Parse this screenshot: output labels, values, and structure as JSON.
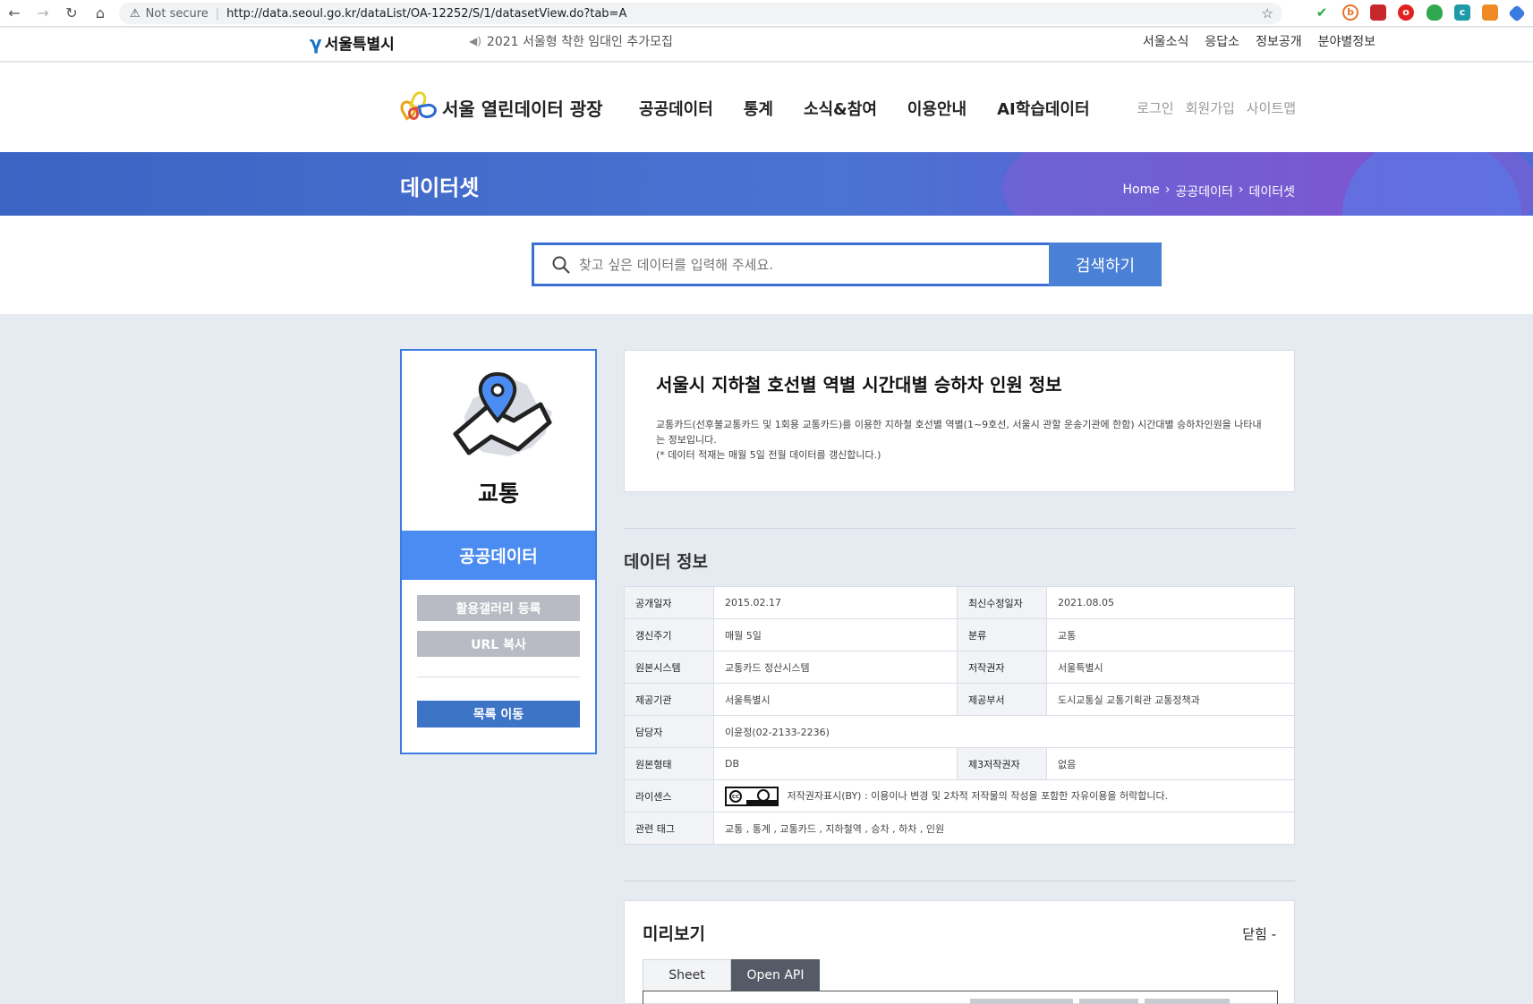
{
  "browser": {
    "security_label": "Not secure",
    "url": "http://data.seoul.go.kr/dataList/OA-12252/S/1/datasetView.do?tab=A"
  },
  "topbar": {
    "logo_text": "서울특별시",
    "notice": "2021 서울형 착한 임대인 추가모집",
    "menu": [
      "서울소식",
      "응답소",
      "정보공개",
      "분야별정보"
    ]
  },
  "header": {
    "site_name": "서울 열린데이터 광장",
    "gnb": [
      "공공데이터",
      "통계",
      "소식&참여",
      "이용안내",
      "AI학습데이터"
    ],
    "member": [
      "로그인",
      "회원가입",
      "사이트맵"
    ]
  },
  "banner": {
    "title": "데이터셋",
    "breadcrumb": [
      "Home",
      "공공데이터",
      "데이터셋"
    ]
  },
  "search": {
    "placeholder": "찾고 싶은 데이터를 입력해 주세요.",
    "button": "검색하기"
  },
  "category_card": {
    "category": "교통",
    "type": "공공데이터",
    "gallery_button": "활용갤러리 등록",
    "url_button": "URL 복사",
    "list_button": "목록 이동"
  },
  "dataset": {
    "title": "서울시 지하철 호선별 역별 시간대별 승하차 인원 정보",
    "desc_line1": "교통카드(선후불교통카드 및 1회용 교통카드)를 이용한 지하철 호선별 역별(1~9호선, 서울시 관할 운송기관에 한함) 시간대별 승하차인원을 나타내",
    "desc_line2": "는 정보입니다.",
    "desc_line3": "(* 데이터 적재는 매월 5일 전월 데이터를 갱신합니다.)"
  },
  "info": {
    "section_title": "데이터 정보",
    "rows": {
      "open_date": {
        "label": "공개일자",
        "value": "2015.02.17"
      },
      "modified": {
        "label": "최신수정일자",
        "value": "2021.08.05"
      },
      "cycle": {
        "label": "갱신주기",
        "value": "매월 5일"
      },
      "category": {
        "label": "분류",
        "value": "교통"
      },
      "system": {
        "label": "원본시스템",
        "value": "교통카드 정산시스템"
      },
      "copyright": {
        "label": "저작권자",
        "value": "서울특별시"
      },
      "provider": {
        "label": "제공기관",
        "value": "서울특별시"
      },
      "dept": {
        "label": "제공부서",
        "value": "도시교통실 교통기획관 교통정책과"
      },
      "manager": {
        "label": "담당자",
        "value": "이윤정(02-2133-2236)"
      },
      "format": {
        "label": "원본형태",
        "value": "DB"
      },
      "third": {
        "label": "제3저작권자",
        "value": "없음"
      },
      "license": {
        "label": "라이센스",
        "value": "저작권자표시(BY) : 이용이나 변경 및 2차적 저작물의 작성을 포함한 자유이용을 허락합니다."
      },
      "tags": {
        "label": "관련 태그",
        "value": "교통 , 통계 , 교통카드 , 지하철역 , 승차 , 하차 , 인원"
      }
    }
  },
  "preview": {
    "title": "미리보기",
    "close": "닫힘 -",
    "tabs": [
      "Sheet",
      "Open API"
    ],
    "active_tab": "Open API"
  },
  "colors": {
    "accent": "#4a8cf2",
    "banner": "#4a73d3",
    "list_button": "#3d74c6",
    "gray_button": "#b8bbc4"
  }
}
